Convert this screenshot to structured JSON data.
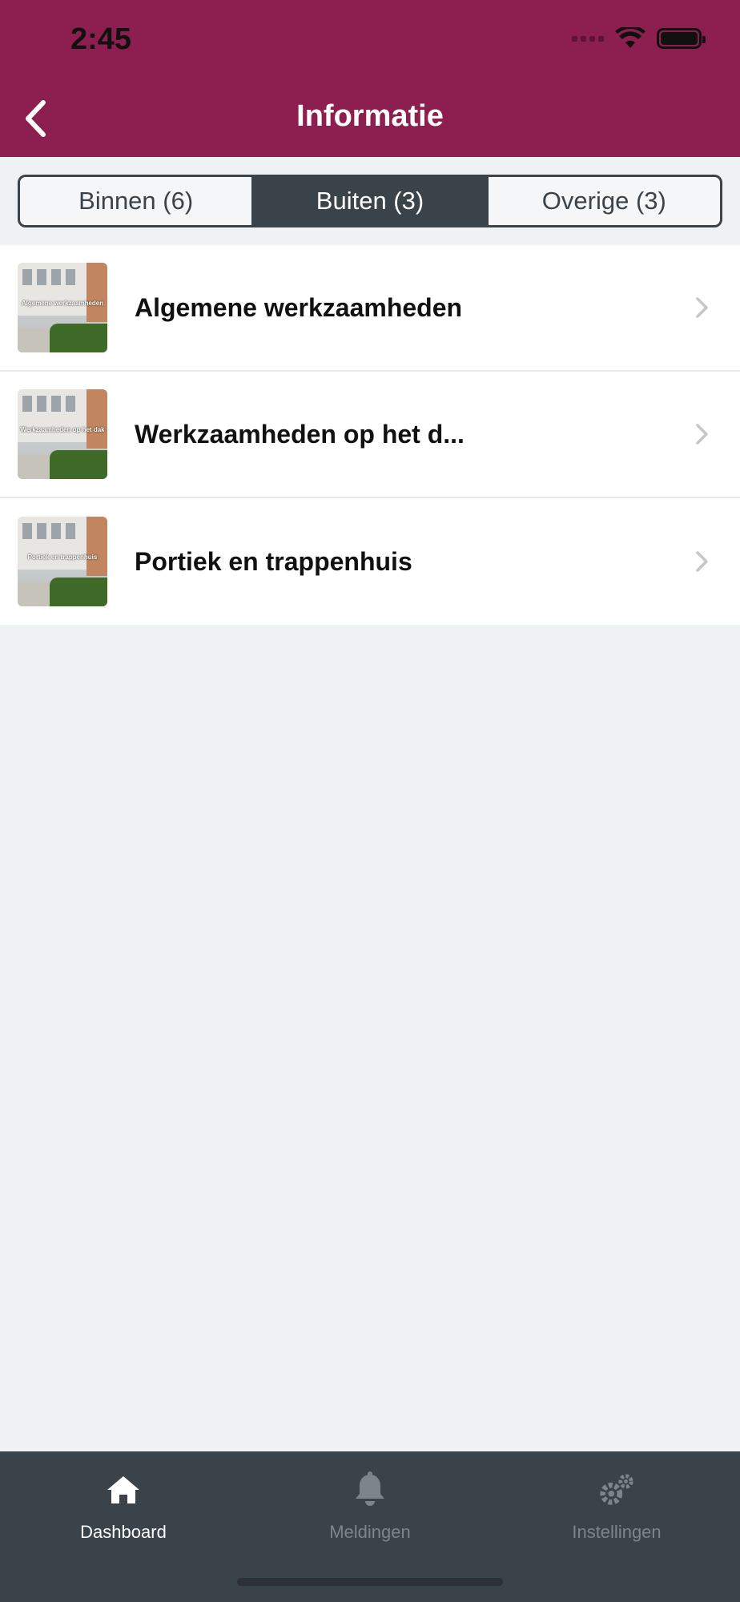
{
  "status_bar": {
    "time": "2:45"
  },
  "header": {
    "title": "Informatie",
    "back_icon": "chevron-left-icon"
  },
  "segments": [
    {
      "label": "Binnen (6)",
      "active": false
    },
    {
      "label": "Buiten (3)",
      "active": true
    },
    {
      "label": "Overige (3)",
      "active": false
    }
  ],
  "items": [
    {
      "title": "Algemene werkzaamheden",
      "thumb_text": "Algemene werkzaamheden"
    },
    {
      "title": "Werkzaamheden op het d...",
      "thumb_text": "Werkzaamheden op het dak"
    },
    {
      "title": "Portiek en trappenhuis",
      "thumb_text": "Portiek en trappenhuis"
    }
  ],
  "tabbar": [
    {
      "label": "Dashboard",
      "icon": "home-icon",
      "active": true
    },
    {
      "label": "Meldingen",
      "icon": "bell-icon",
      "active": false
    },
    {
      "label": "Instellingen",
      "icon": "gears-icon",
      "active": false
    }
  ],
  "colors": {
    "brand": "#8c1f4f",
    "dark": "#3a424a",
    "background": "#eef2f5"
  }
}
